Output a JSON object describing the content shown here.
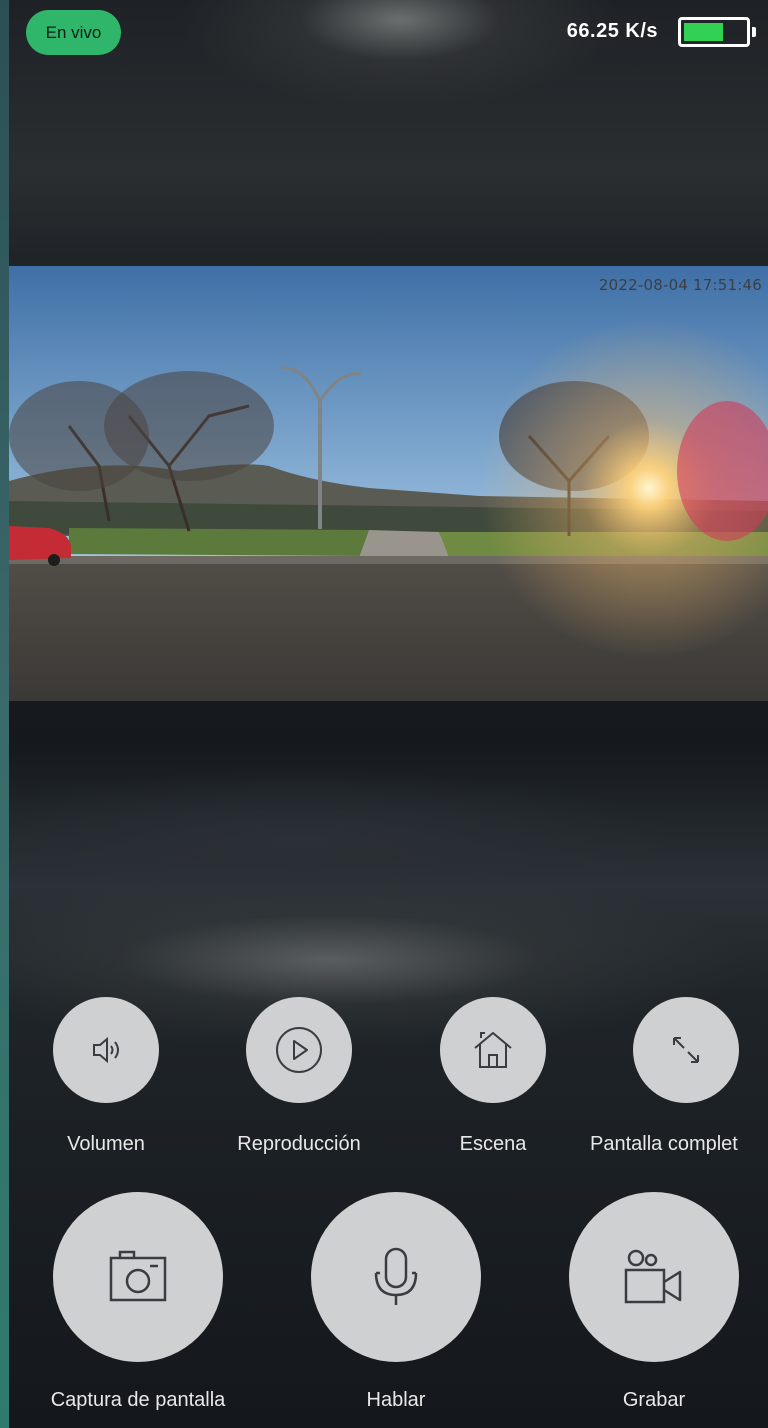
{
  "status_bar": {
    "live_label": "En vivo",
    "speed": "66.25 K/s",
    "battery_level_percent": 65,
    "battery_color": "#33d056"
  },
  "video": {
    "timestamp": "2022-08-04  17:51:46"
  },
  "controls": {
    "small": [
      {
        "label": "Volumen",
        "icon": "volume-icon"
      },
      {
        "label": "Reproducción",
        "icon": "play-circle-icon"
      },
      {
        "label": "Escena",
        "icon": "home-icon"
      },
      {
        "label": "Pantalla complet",
        "icon": "fullscreen-icon"
      }
    ],
    "large": [
      {
        "label": "Captura de pantalla",
        "icon": "camera-icon"
      },
      {
        "label": "Hablar",
        "icon": "microphone-icon"
      },
      {
        "label": "Grabar",
        "icon": "video-camera-icon"
      }
    ]
  },
  "colors": {
    "live_badge": "#2fb66b",
    "button_background": "#cfd0d1",
    "icon_stroke": "#3a3d40"
  }
}
